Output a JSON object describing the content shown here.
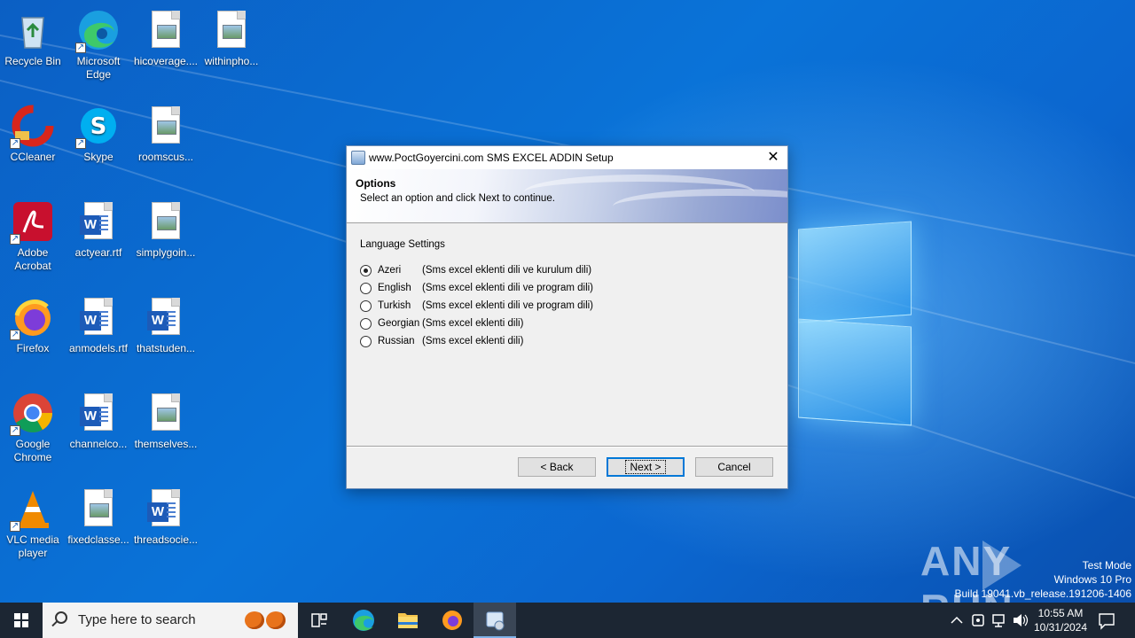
{
  "desktop": {
    "icons": [
      {
        "label": "Recycle Bin",
        "icon": "recycle-bin-icon"
      },
      {
        "label": "Microsoft Edge",
        "icon": "edge-icon"
      },
      {
        "label": "hicoverage....",
        "icon": "image-file-icon"
      },
      {
        "label": "withinpho...",
        "icon": "image-file-icon"
      },
      {
        "label": "CCleaner",
        "icon": "ccleaner-icon"
      },
      {
        "label": "Skype",
        "icon": "skype-icon"
      },
      {
        "label": "roomscus...",
        "icon": "image-file-icon"
      },
      {
        "label": "Adobe Acrobat",
        "icon": "acrobat-icon"
      },
      {
        "label": "actyear.rtf",
        "icon": "word-doc-icon"
      },
      {
        "label": "simplygoin...",
        "icon": "image-file-icon"
      },
      {
        "label": "Firefox",
        "icon": "firefox-icon"
      },
      {
        "label": "anmodels.rtf",
        "icon": "word-doc-icon"
      },
      {
        "label": "thatstuden...",
        "icon": "word-doc-icon"
      },
      {
        "label": "Google Chrome",
        "icon": "chrome-icon"
      },
      {
        "label": "channelco...",
        "icon": "word-doc-icon"
      },
      {
        "label": "themselves...",
        "icon": "image-file-icon"
      },
      {
        "label": "VLC media player",
        "icon": "vlc-icon"
      },
      {
        "label": "fixedclasse...",
        "icon": "image-file-icon"
      },
      {
        "label": "threadsocie...",
        "icon": "word-doc-icon"
      }
    ],
    "watermark": "ANY RUN",
    "system_info": {
      "line1": "Test Mode",
      "line2": "Windows 10 Pro",
      "line3": "Build 19041.vb_release.191206-1406"
    }
  },
  "dialog": {
    "title": "www.PoctGoyercini.com SMS EXCEL ADDIN Setup",
    "close_label": "✕",
    "header": "Options",
    "subheader": "Select an option and click Next to continue.",
    "group_label": "Language Settings",
    "options": [
      {
        "name": "Azeri",
        "desc": "(Sms excel eklenti dili ve kurulum dili)",
        "checked": true
      },
      {
        "name": "English",
        "desc": "(Sms excel eklenti dili ve program dili)",
        "checked": false
      },
      {
        "name": "Turkish",
        "desc": "(Sms excel eklenti dili ve program dili)",
        "checked": false
      },
      {
        "name": "Georgian",
        "desc": "(Sms excel eklenti dili)",
        "checked": false
      },
      {
        "name": "Russian",
        "desc": "(Sms excel eklenti dili)",
        "checked": false
      }
    ],
    "buttons": {
      "back": "< Back",
      "next": "Next >",
      "cancel": "Cancel"
    }
  },
  "taskbar": {
    "search_placeholder": "Type here to search",
    "time": "10:55 AM",
    "date": "10/31/2024",
    "accent": "#0078d7"
  }
}
